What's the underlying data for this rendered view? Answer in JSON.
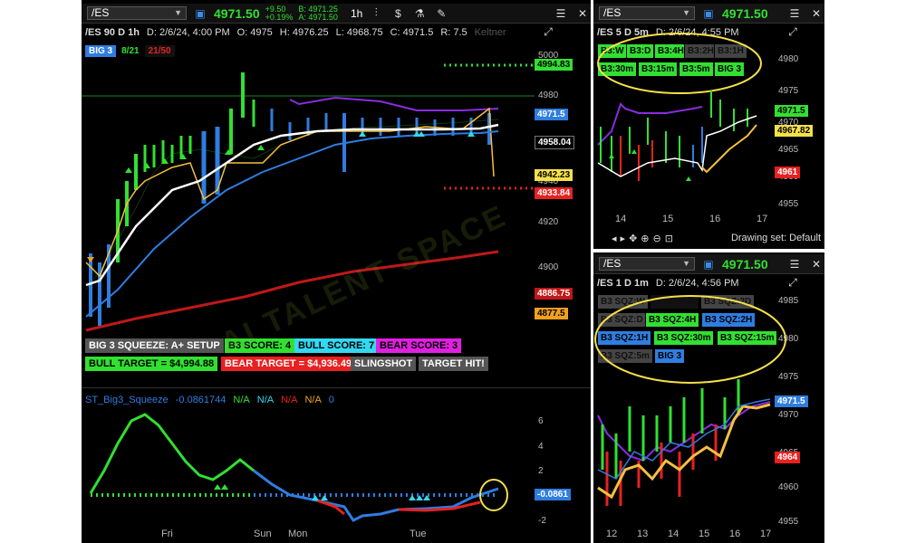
{
  "main": {
    "symbol": "/ES",
    "price": "4971.50",
    "change": "+9.50",
    "change_pct": "+0.19%",
    "bid": "B: 4971.25",
    "ask": "A: 4971.50",
    "timeframe": "1h",
    "info": "/ES 90 D 1h",
    "date": "D: 2/6/24, 4:00 PM",
    "open": "O: 4975",
    "high": "H: 4976.25",
    "low": "L: 4968.75",
    "close": "C: 4971.5",
    "range": "R: 7.5",
    "study_faded": "Keltner",
    "tags": [
      "BIG 3",
      "8/21",
      "21/50"
    ],
    "axis_labels": [
      "5000",
      "4980",
      "4960",
      "4940",
      "4920",
      "4900"
    ],
    "price_tags": [
      "4994.83",
      "4971.5",
      "4958.04",
      "4942.23",
      "4933.84",
      "4886.75",
      "4877.5"
    ],
    "buttons": {
      "squeeze": "BIG 3 SQUEEZE: A+ SETUP",
      "b3score": "B3 SCORE:  4",
      "bull": "BULL SCORE:  7",
      "bear": "BEAR SCORE:  3",
      "bull_target": "BULL TARGET = $4,994.88",
      "bear_target": "BEAR TARGET = $4,936.49",
      "slingshot": "SLINGSHOT",
      "target_hit": "TARGET HIT!"
    },
    "lower": {
      "name": "ST_Big3_Squeeze",
      "value": "-0.0861744",
      "na": [
        "N/A",
        "N/A",
        "N/A",
        "N/A",
        "0"
      ],
      "axis": [
        "6",
        "4",
        "2",
        "0",
        "-2"
      ],
      "tag": "-0.0861"
    },
    "x_labels": [
      "Fri",
      "Sun",
      "Mon",
      "Tue"
    ]
  },
  "top_right": {
    "symbol": "/ES",
    "price": "4971.50",
    "info": "/ES 5 D 5m",
    "date": "D: 2/6/24, 4:55 PM",
    "boxes": [
      "B3:W",
      "B3:D",
      "B3:4H",
      "B3:2H",
      "B3:1H",
      "B3:30m",
      "B3:15m",
      "B3:5m",
      "BIG 3"
    ],
    "axis": [
      "4980",
      "4975",
      "4970",
      "4965",
      "4960",
      "4955"
    ],
    "price_tags": [
      "4971.5",
      "4967.82",
      "4961"
    ],
    "x_labels": [
      "14",
      "15",
      "16",
      "17"
    ],
    "drawing_set": "Drawing set: Default"
  },
  "bottom_right": {
    "symbol": "/ES",
    "price": "4971.50",
    "info": "/ES 1 D 1m",
    "date": "D: 2/6/24, 4:56 PM",
    "boxes": [
      "B3 SQZ:W",
      "B3 SQZ:D",
      "B3 SQZ:2D",
      "B3 SQZ:D",
      "B3 SQZ:4H",
      "B3 SQZ:2H",
      "B3 SQZ:1H",
      "B3 SQZ:30m",
      "B3 SQZ:15m",
      "B3 SQZ:5m",
      "BIG 3"
    ],
    "axis": [
      "4985",
      "4980",
      "4975",
      "4970",
      "4965",
      "4960",
      "4955"
    ],
    "price_tags": [
      "4971.5",
      "4964"
    ],
    "x_labels": [
      "12",
      "13",
      "14",
      "15",
      "16",
      "17"
    ]
  },
  "watermark": "AI TALENT SPACE",
  "colors": {
    "green": "#31e031",
    "red": "#e82020",
    "blue": "#2f7de0",
    "yellow": "#f5e04a",
    "orange": "#f0a020",
    "purple": "#8a2be2"
  }
}
